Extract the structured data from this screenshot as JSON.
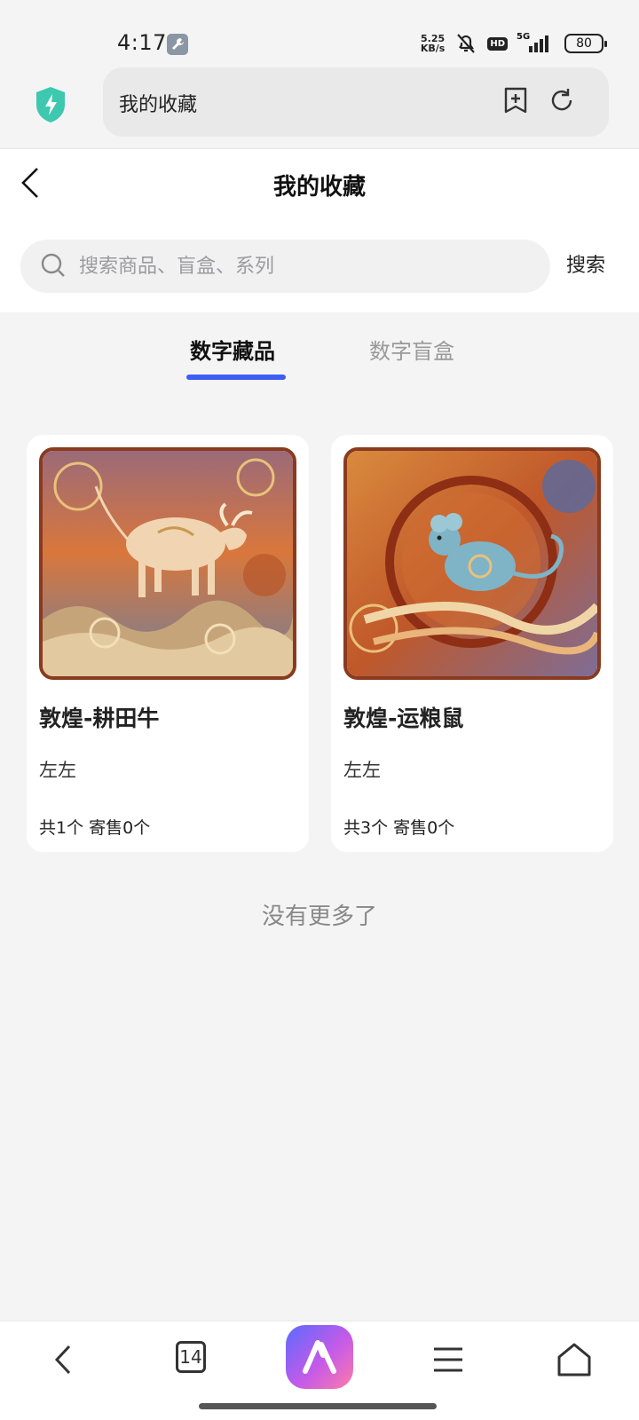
{
  "status_bar": {
    "time": "4:17",
    "speed_value": "5.25",
    "speed_unit": "KB/s",
    "hd_label": "HD",
    "network": "5G",
    "battery": "80"
  },
  "browser": {
    "address_text": "我的收藏"
  },
  "header": {
    "title": "我的收藏"
  },
  "search": {
    "placeholder": "搜索商品、盲盒、系列",
    "button_label": "搜索"
  },
  "tabs": [
    {
      "label": "数字藏品",
      "active": true
    },
    {
      "label": "数字盲盒",
      "active": false
    }
  ],
  "items": [
    {
      "name": "敦煌-耕田牛",
      "author": "左左",
      "stats": "共1个 寄售0个"
    },
    {
      "name": "敦煌-运粮鼠",
      "author": "左左",
      "stats": "共3个 寄售0个"
    }
  ],
  "footer_note": "没有更多了",
  "bottom_nav": {
    "tab_count": "14"
  },
  "colors": {
    "accent": "#3d5ef5",
    "shield": "#3ec8b0"
  }
}
